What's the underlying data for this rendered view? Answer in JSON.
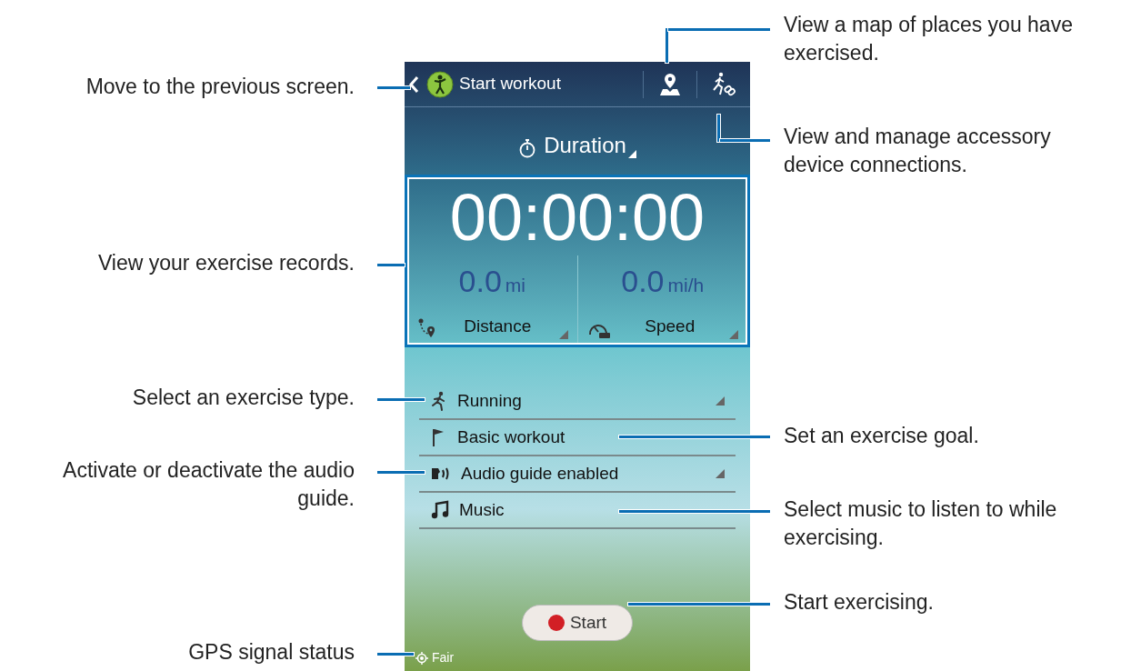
{
  "screen": {
    "title": "Start workout",
    "mode": "Duration",
    "timer": "00:00:00",
    "stats": [
      {
        "kind": "distance",
        "value": "0.0",
        "unit": "mi",
        "label": "Distance"
      },
      {
        "kind": "speed",
        "value": "0.0",
        "unit": "mi/h",
        "label": "Speed"
      }
    ],
    "rows": [
      {
        "kind": "type",
        "label": "Running",
        "dropdown": true
      },
      {
        "kind": "goal",
        "label": "Basic workout",
        "dropdown": false
      },
      {
        "kind": "audio",
        "label": "Audio guide enabled",
        "dropdown": true
      },
      {
        "kind": "music",
        "label": "Music",
        "dropdown": false
      }
    ],
    "start_button": "Start",
    "gps_status": "Fair"
  },
  "callouts_left": [
    "Move to the previous screen.",
    "View your exercise records.",
    "Select an exercise type.",
    "Activate or deactivate the audio guide.",
    "GPS signal status"
  ],
  "callouts_right": [
    "View a map of places you have exercised.",
    "View and manage accessory device connections.",
    "Set an exercise goal.",
    "Select music to listen to while exercising.",
    "Start exercising."
  ]
}
